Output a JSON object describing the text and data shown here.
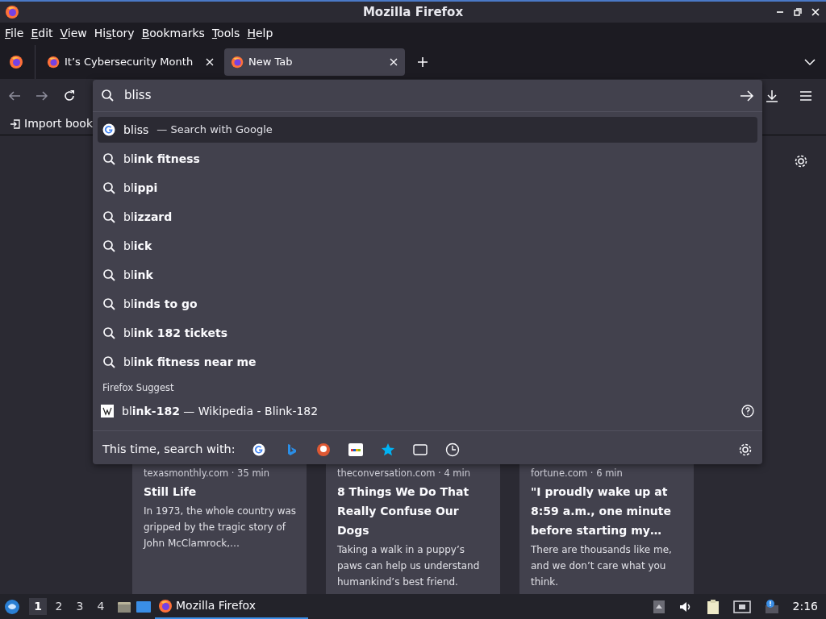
{
  "window": {
    "title": "Mozilla Firefox"
  },
  "menu": [
    {
      "access_key": "F",
      "rest": "ile"
    },
    {
      "access_key": "E",
      "rest": "dit"
    },
    {
      "access_key": "V",
      "rest": "iew"
    },
    {
      "lead": "Hi",
      "access_key": "s",
      "rest": "tory"
    },
    {
      "access_key": "B",
      "rest": "ookmarks"
    },
    {
      "access_key": "T",
      "rest": "ools"
    },
    {
      "access_key": "H",
      "rest": "elp"
    }
  ],
  "tabs": [
    {
      "title": "It’s Cybersecurity Month",
      "selected": false
    },
    {
      "title": "New Tab",
      "selected": true
    }
  ],
  "address_bar": {
    "value": "bliss"
  },
  "bookmarks_bar": {
    "items": [
      "Import book"
    ]
  },
  "suggestions": [
    {
      "kind": "engine",
      "text": "bliss",
      "action": "— Search with Google",
      "selected": true
    },
    {
      "kind": "suggestion",
      "text": "bl**ink fitness**",
      "selected": false
    },
    {
      "kind": "suggestion",
      "text": "bl**ippi**",
      "selected": false
    },
    {
      "kind": "suggestion",
      "text": "bl**izzard**",
      "selected": false
    },
    {
      "kind": "suggestion",
      "text": "bl**ick**",
      "selected": false
    },
    {
      "kind": "suggestion",
      "text": "bl**ink**",
      "selected": false
    },
    {
      "kind": "suggestion",
      "text": "bl**inds to go**",
      "selected": false
    },
    {
      "kind": "suggestion",
      "text": "bl**ink 182 tickets**",
      "selected": false
    },
    {
      "kind": "suggestion",
      "text": "bl**ink fitness near me**",
      "selected": false
    }
  ],
  "firefox_suggest": {
    "heading": "Firefox Suggest",
    "text": "bl**ink-182** — Wikipedia - Blink-182"
  },
  "search_with": {
    "label": "This time, search with:"
  },
  "stories": [
    {
      "source": "texasmonthly.com · 35 min",
      "title": "Still Life",
      "excerpt": "In 1973, the whole country was gripped by the tragic story of John McClamrock,…"
    },
    {
      "source": "theconversation.com · 4 min",
      "title": "8 Things We Do That Really Confuse Our Dogs",
      "excerpt": "Taking a walk in a puppy’s paws can help us understand humankind’s best friend."
    },
    {
      "source": "fortune.com · 6 min",
      "title": "\"I proudly wake up at 8:59 a.m., one minute before starting my…",
      "excerpt": "There are thousands like me, and we don’t care what you think."
    }
  ],
  "taskbar": {
    "workspaces": [
      {
        "label": "1",
        "selected": true
      },
      {
        "label": "2",
        "selected": false
      },
      {
        "label": "3",
        "selected": false
      },
      {
        "label": "4",
        "selected": false
      }
    ],
    "task": "Mozilla Firefox",
    "clock": "2:16"
  }
}
